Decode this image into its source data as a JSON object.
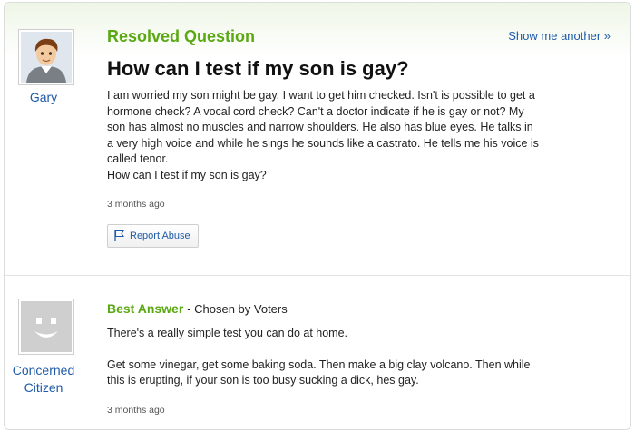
{
  "question": {
    "label": "Resolved Question",
    "show_another": "Show me another »",
    "title": "How can I test if my son is gay?",
    "body_lines": [
      "I am worried my son might be gay. I want to get him checked. Isn't is possible to get a",
      "hormone check? A vocal cord check? Can't a doctor indicate if he is gay or not? My",
      "son has almost no muscles and narrow shoulders. He also has blue eyes. He talks in",
      "a very high voice and while he sings he sounds like a castrato. He tells me his voice is",
      "called tenor.",
      "How can I test if my son is gay?"
    ],
    "asker": "Gary",
    "time": "3 months ago",
    "report_label": "Report Abuse",
    "report_icon": "flag-icon"
  },
  "answer": {
    "label": "Best Answer",
    "chosen": "- Chosen by Voters",
    "paragraph1": "There's a really simple test you can do at home.",
    "paragraph2_lines": [
      "Get some vinegar, get some baking soda. Then make a big clay volcano. Then while",
      "this is erupting, if your son is too busy sucking a dick, hes gay."
    ],
    "user_line1": "Concerned",
    "user_line2": "Citizen",
    "time": "3 months ago",
    "avatar_icon": "smiley-avatar-icon"
  }
}
